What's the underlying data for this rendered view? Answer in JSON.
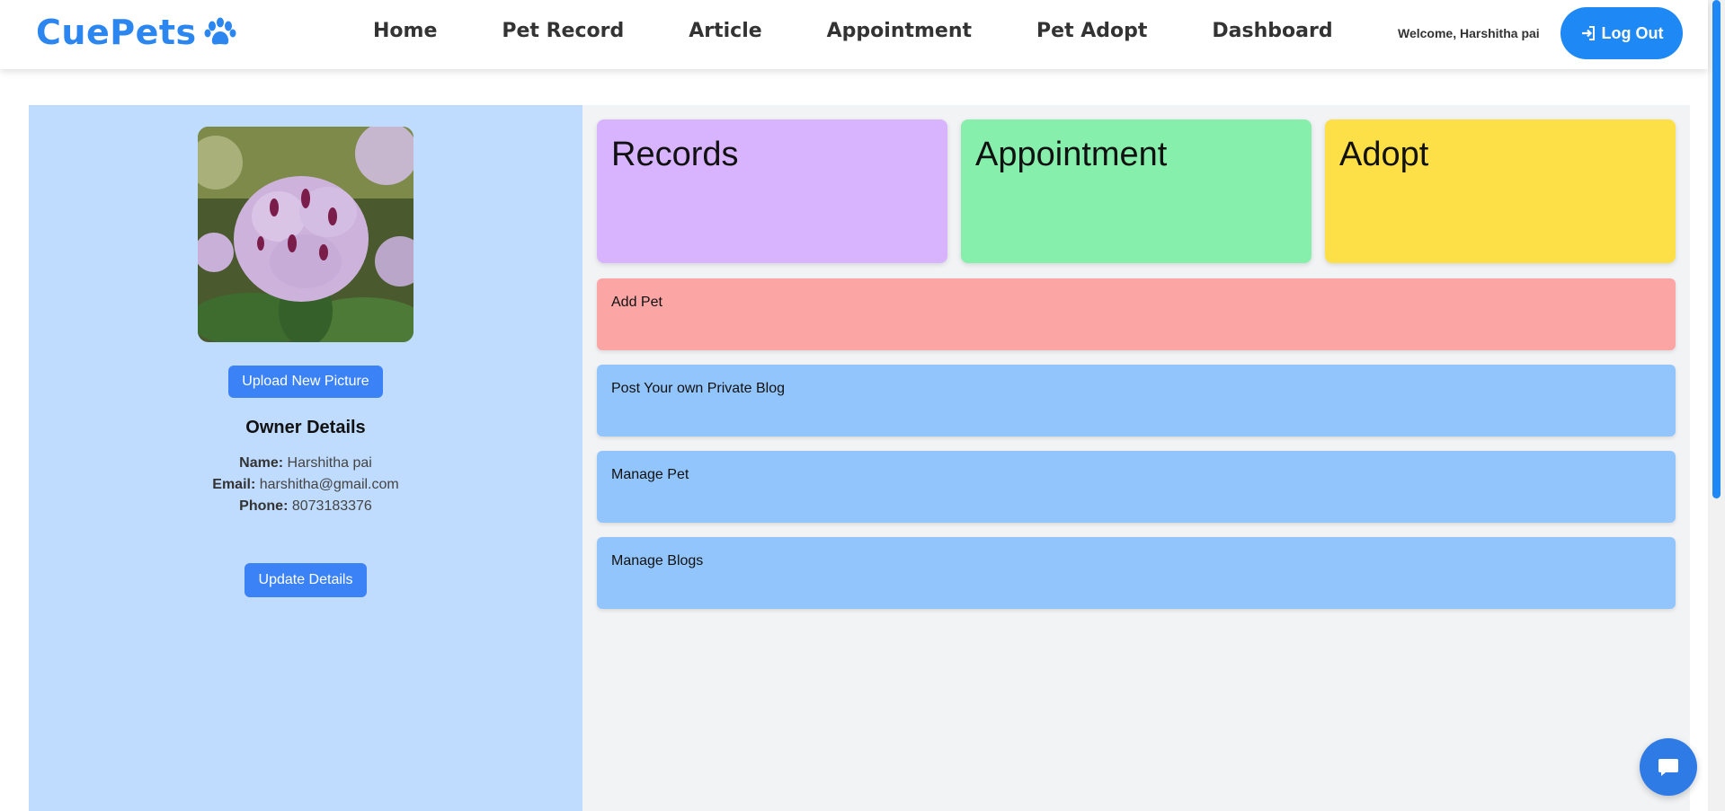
{
  "app": {
    "logo": "CuePets"
  },
  "nav": {
    "items": [
      "Home",
      "Pet Record",
      "Article",
      "Appointment",
      "Pet Adopt",
      "Dashboard"
    ]
  },
  "header": {
    "welcome": "Welcome, Harshitha pai",
    "logout_label": "Log Out"
  },
  "profile": {
    "upload_label": "Upload New Picture",
    "owner_title": "Owner Details",
    "name_label": "Name:",
    "name": "Harshitha pai",
    "email_label": "Email:",
    "email": "harshitha@gmail.com",
    "phone_label": "Phone:",
    "phone": "8073183376",
    "update_label": "Update Details"
  },
  "cards": [
    {
      "label": "Records",
      "color": "#d8b4fe"
    },
    {
      "label": "Appointment",
      "color": "#86efac"
    },
    {
      "label": "Adopt",
      "color": "#fde047"
    }
  ],
  "actions": [
    {
      "label": "Add Pet",
      "color": "#fca5a5"
    },
    {
      "label": "Post Your own Private Blog",
      "color": "#93c5fd"
    },
    {
      "label": "Manage Pet",
      "color": "#93c5fd"
    },
    {
      "label": "Manage Blogs",
      "color": "#93c5fd"
    }
  ],
  "colors": {
    "brand": "#2c86f0",
    "button": "#3b82f6",
    "panel": "#bfdbfe"
  },
  "icons": {
    "logo": "paw-icon",
    "logout": "login-icon",
    "chat": "chat-bubble-icon"
  }
}
